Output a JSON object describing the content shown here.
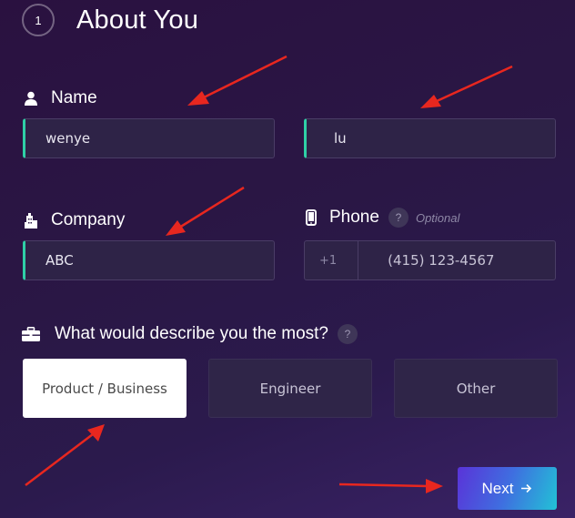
{
  "step": {
    "number": "1",
    "title": "About You"
  },
  "name": {
    "label": "Name",
    "first_value": "wenye",
    "last_value": "lu"
  },
  "company": {
    "label": "Company",
    "value": "ABC"
  },
  "phone": {
    "label": "Phone",
    "help": "?",
    "optional": "Optional",
    "country_code": "+1",
    "placeholder": "(415) 123-4567"
  },
  "describe": {
    "question": "What would describe you the most?",
    "help": "?",
    "options": [
      {
        "label": "Product / Business",
        "selected": true
      },
      {
        "label": "Engineer",
        "selected": false
      },
      {
        "label": "Other",
        "selected": false
      }
    ]
  },
  "next_button": {
    "label": "Next",
    "icon": "arrow-right-icon"
  },
  "colors": {
    "accent_focus": "#2fd0a6",
    "annotation_arrow": "#e8271f",
    "button_gradient_start": "#5a33d8",
    "button_gradient_end": "#22c2d6"
  }
}
